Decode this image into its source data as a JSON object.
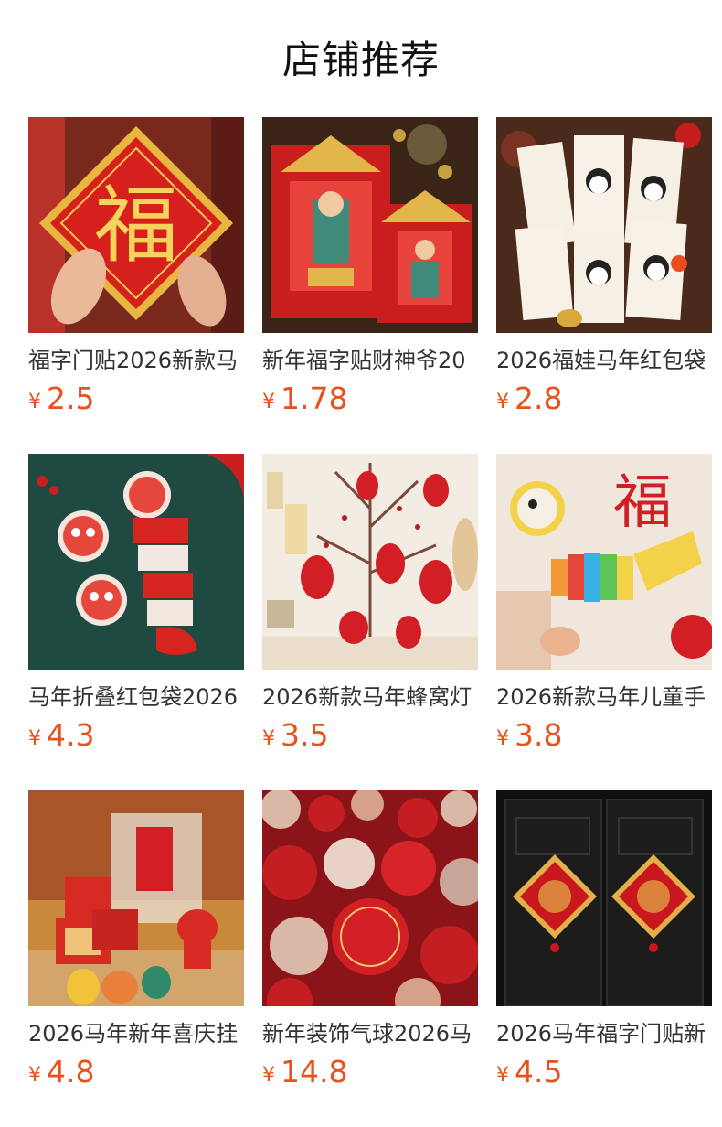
{
  "header": {
    "title": "店铺推荐"
  },
  "products": [
    {
      "name": "福字门贴2026新款马",
      "currency": "¥",
      "price": "2.5",
      "image": "fu-diamond-sticker",
      "image_char": "福"
    },
    {
      "name": "新年福字贴财神爷20",
      "currency": "¥",
      "price": "1.78",
      "image": "caishen-door-sticker"
    },
    {
      "name": "2026福娃马年红包袋",
      "currency": "¥",
      "price": "2.8",
      "image": "panda-red-envelopes"
    },
    {
      "name": "马年折叠红包袋2026",
      "currency": "¥",
      "price": "4.3",
      "image": "lion-fold-envelope"
    },
    {
      "name": "2026新款马年蜂窝灯",
      "currency": "¥",
      "price": "3.5",
      "image": "honeycomb-lanterns"
    },
    {
      "name": "2026新款马年儿童手",
      "currency": "¥",
      "price": "3.8",
      "image": "kids-dragon-toy",
      "image_char": "福"
    },
    {
      "name": "2026马年新年喜庆挂",
      "currency": "¥",
      "price": "4.8",
      "image": "gift-box-ornaments"
    },
    {
      "name": "新年装饰气球2026马",
      "currency": "¥",
      "price": "14.8",
      "image": "red-balloons"
    },
    {
      "name": "2026马年福字门贴新",
      "currency": "¥",
      "price": "4.5",
      "image": "door-fu-stickers"
    }
  ]
}
